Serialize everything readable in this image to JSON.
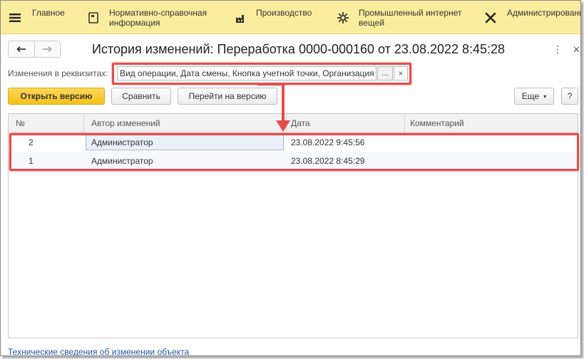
{
  "nav": {
    "items": [
      {
        "label": "Главное",
        "icon": "hamburger-icon"
      },
      {
        "label": "Нормативно-справочная\nинформация",
        "icon": "book-icon"
      },
      {
        "label": "Производство",
        "icon": "factory-icon"
      },
      {
        "label": "Промышленный интернет\nвещей",
        "icon": "iot-icon"
      },
      {
        "label": "Администрирование",
        "icon": "tools-icon"
      }
    ]
  },
  "title": "История изменений: Переработка 0000-000160 от 23.08.2022 8:45:28",
  "filter": {
    "label": "Изменения в реквизитах:",
    "value": "Вид операции, Дата смены, Кнопка учетной точки, Организация",
    "select_label": "...",
    "clear_label": "×"
  },
  "toolbar": {
    "open_version": "Открыть версию",
    "compare": "Сравнить",
    "goto_version": "Перейти на версию",
    "more": "Еще",
    "help": "?"
  },
  "table": {
    "columns": [
      "№",
      "Автор изменений",
      "Дата",
      "Комментарий"
    ],
    "rows": [
      {
        "num": "2",
        "author": "Администратор",
        "date": "23.08.2022 9:45:56",
        "comment": ""
      },
      {
        "num": "1",
        "author": "Администратор",
        "date": "23.08.2022 8:45:29",
        "comment": ""
      }
    ]
  },
  "footer_link": "Технические сведения об изменении объекта",
  "colors": {
    "topbar": "#fbed9e",
    "primary_button": "#f5c21b",
    "highlight": "#e74c4c",
    "link": "#2255aa"
  }
}
